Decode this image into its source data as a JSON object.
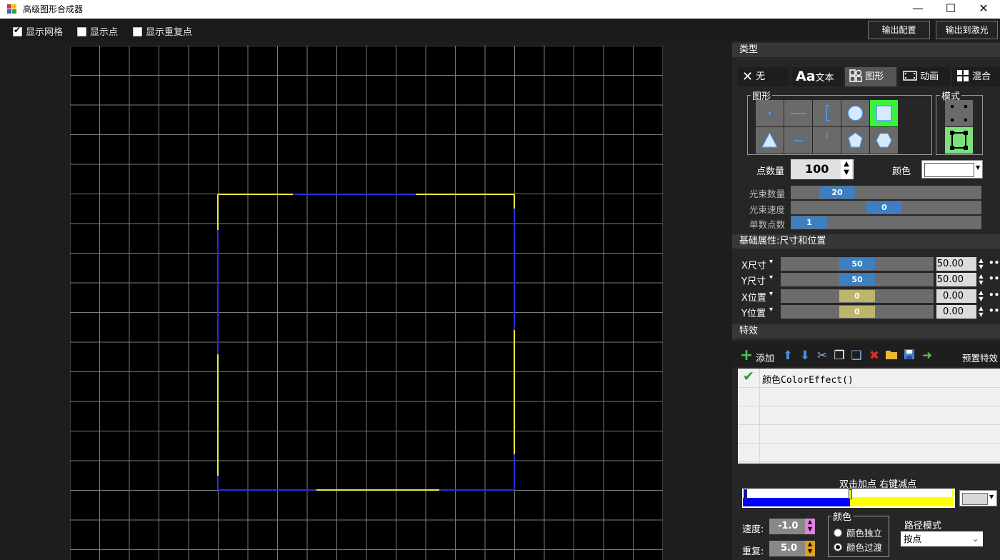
{
  "window": {
    "title": "高级图形合成器",
    "minimize_glyph": "—",
    "maximize_glyph": "☐",
    "close_glyph": "✕"
  },
  "toolbar": {
    "show_grid": {
      "label": "显示网格",
      "checked": true
    },
    "show_points": {
      "label": "显示点",
      "checked": false
    },
    "show_repeat_points": {
      "label": "显示重复点",
      "checked": false
    },
    "export_config_label": "输出配置",
    "export_laser_label": "输出到激光"
  },
  "canvas": {
    "grid_color": "#7a7a7a",
    "shape_colors": [
      "#f0f040",
      "#2020e0"
    ]
  },
  "type_section": {
    "header": "类型",
    "tabs": [
      {
        "label": "无",
        "icon": "x-icon",
        "selected": false
      },
      {
        "label": "文本",
        "icon": "text-aa-icon",
        "selected": false
      },
      {
        "label": "图形",
        "icon": "shapes-icon",
        "selected": true
      },
      {
        "label": "动画",
        "icon": "film-icon",
        "selected": false
      },
      {
        "label": "混合",
        "icon": "grid-icon",
        "selected": false
      }
    ]
  },
  "shape_group": {
    "label": "图形",
    "shapes": [
      "dot",
      "horizontal-line",
      "bracket",
      "circle",
      "square",
      "triangle",
      "short-line",
      "tick",
      "pentagon",
      "hexagon"
    ],
    "selected": "square"
  },
  "mode_group": {
    "label": "模式",
    "modes": [
      "points-mode",
      "outline-mode"
    ],
    "selected": "outline-mode"
  },
  "point_count": {
    "label": "点数量",
    "value": "100"
  },
  "color": {
    "label": "颜色",
    "value": "#ffffff"
  },
  "beam_sliders": [
    {
      "label": "光束数量",
      "value": "20"
    },
    {
      "label": "光束速度",
      "value": "0"
    },
    {
      "label": "单数点数",
      "value": "1"
    }
  ],
  "basic_section": {
    "header": "基础属性:尺寸和位置",
    "rows": [
      {
        "label": "X尺寸",
        "slider": "50",
        "value": "50.00",
        "style": "blue"
      },
      {
        "label": "Y尺寸",
        "slider": "50",
        "value": "50.00",
        "style": "blue"
      },
      {
        "label": "X位置",
        "slider": "0",
        "value": "0.00",
        "style": "yellow"
      },
      {
        "label": "Y位置",
        "slider": "0",
        "value": "0.00",
        "style": "yellow"
      }
    ],
    "dropdown_glyph": "▾",
    "more_glyph": "•••"
  },
  "effects_section": {
    "header": "特效",
    "add_label": "添加",
    "preset_label": "预置特效",
    "toolbar_icons": [
      "add-icon",
      "move-up-icon",
      "move-down-icon",
      "cut-icon",
      "copy-icon",
      "paste-icon",
      "delete-icon",
      "folder-icon",
      "save-icon",
      "export-icon"
    ],
    "items": [
      {
        "label": "颜色ColorEffect()",
        "enabled": true
      }
    ]
  },
  "gradient": {
    "hint": "双击加点 右键减点",
    "stops": [
      "#0000ff",
      "#ffff00"
    ]
  },
  "speed": {
    "label": "速度:",
    "value": "-1.0",
    "accent": "#e080e0"
  },
  "repeat": {
    "label": "重复:",
    "value": "5.0",
    "accent": "#e0a020"
  },
  "color_mode": {
    "label": "颜色",
    "options": [
      {
        "label": "颜色独立",
        "checked": false
      },
      {
        "label": "颜色过渡",
        "checked": true
      }
    ]
  },
  "path_mode": {
    "label": "路径模式",
    "value": "按点"
  }
}
